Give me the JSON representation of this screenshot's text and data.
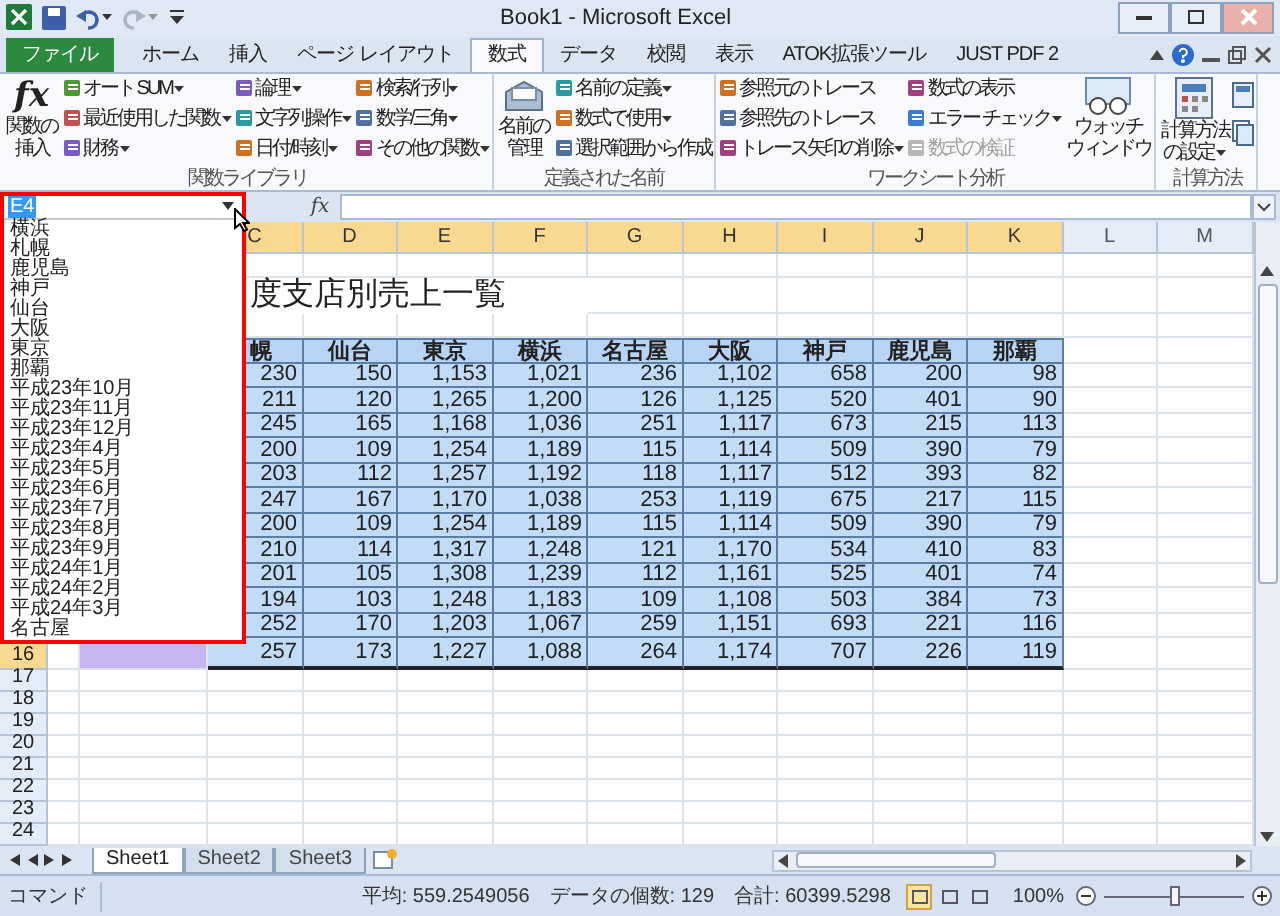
{
  "window": {
    "title": "Book1 - Microsoft Excel"
  },
  "ribbon_tabs": [
    {
      "label": "ファイル",
      "kind": "file",
      "selected": false
    },
    {
      "label": "ホーム",
      "kind": "tab",
      "selected": false
    },
    {
      "label": "挿入",
      "kind": "tab",
      "selected": false
    },
    {
      "label": "ページ レイアウト",
      "kind": "tab",
      "selected": false
    },
    {
      "label": "数式",
      "kind": "tab",
      "selected": true
    },
    {
      "label": "データ",
      "kind": "tab",
      "selected": false
    },
    {
      "label": "校閲",
      "kind": "tab",
      "selected": false
    },
    {
      "label": "表示",
      "kind": "tab",
      "selected": false
    },
    {
      "label": "ATOK拡張ツール",
      "kind": "tab",
      "selected": false
    },
    {
      "label": "JUST PDF 2",
      "kind": "tab",
      "selected": false
    }
  ],
  "ribbon_groups": [
    {
      "label": "関数ライブラリ",
      "parts": [
        {
          "kind": "big",
          "glyph": "fx",
          "lines": [
            "関数の",
            "挿入"
          ],
          "dropdown": false
        },
        {
          "kind": "stack",
          "items": [
            {
              "label": "オート SUM",
              "dropdown": true,
              "disabled": false
            },
            {
              "label": "最近使用した関数",
              "dropdown": true,
              "disabled": false
            },
            {
              "label": "財務",
              "dropdown": true,
              "disabled": false
            }
          ]
        },
        {
          "kind": "stack",
          "items": [
            {
              "label": "論理",
              "dropdown": true,
              "disabled": false
            },
            {
              "label": "文字列操作",
              "dropdown": true,
              "disabled": false
            },
            {
              "label": "日付/時刻",
              "dropdown": true,
              "disabled": false
            }
          ]
        },
        {
          "kind": "stack",
          "items": [
            {
              "label": "検索/行列",
              "dropdown": true,
              "disabled": false
            },
            {
              "label": "数学/三角",
              "dropdown": true,
              "disabled": false
            },
            {
              "label": "その他の関数",
              "dropdown": true,
              "disabled": false
            }
          ]
        }
      ]
    },
    {
      "label": "定義された名前",
      "parts": [
        {
          "kind": "big",
          "lines": [
            "名前の",
            "管理"
          ],
          "dropdown": false
        },
        {
          "kind": "stack",
          "items": [
            {
              "label": "名前の定義",
              "dropdown": true,
              "disabled": false
            },
            {
              "label": "数式で使用",
              "dropdown": true,
              "disabled": false
            },
            {
              "label": "選択範囲から作成",
              "dropdown": false,
              "disabled": false
            }
          ]
        }
      ]
    },
    {
      "label": "ワークシート分析",
      "parts": [
        {
          "kind": "stack",
          "items": [
            {
              "label": "参照元のトレース",
              "dropdown": false,
              "disabled": false
            },
            {
              "label": "参照先のトレース",
              "dropdown": false,
              "disabled": false
            },
            {
              "label": "トレース矢印の削除",
              "dropdown": true,
              "disabled": false
            }
          ]
        },
        {
          "kind": "stack",
          "items": [
            {
              "label": "数式の表示",
              "dropdown": false,
              "disabled": false
            },
            {
              "label": "エラー チェック",
              "dropdown": true,
              "disabled": false
            },
            {
              "label": "数式の検証",
              "dropdown": false,
              "disabled": true
            }
          ]
        },
        {
          "kind": "big",
          "lines": [
            "ウォッチ",
            "ウィンドウ"
          ],
          "dropdown": false
        }
      ]
    },
    {
      "label": "計算方法",
      "parts": [
        {
          "kind": "big",
          "lines": [
            "計算方法",
            "の設定"
          ],
          "dropdown": true
        },
        {
          "kind": "icons"
        }
      ]
    }
  ],
  "name_box": {
    "value": "E4"
  },
  "name_list": [
    "横浜",
    "札幌",
    "鹿児島",
    "神戸",
    "仙台",
    "大阪",
    "東京",
    "那覇",
    "平成23年10月",
    "平成23年11月",
    "平成23年12月",
    "平成23年4月",
    "平成23年5月",
    "平成23年6月",
    "平成23年7月",
    "平成23年8月",
    "平成23年9月",
    "平成24年1月",
    "平成24年2月",
    "平成24年3月",
    "名古屋"
  ],
  "formula_bar": {
    "fx": "fx"
  },
  "sheet": {
    "columns": [
      {
        "label": "C",
        "selected": true
      },
      {
        "label": "D",
        "selected": true
      },
      {
        "label": "E",
        "selected": true
      },
      {
        "label": "F",
        "selected": true
      },
      {
        "label": "G",
        "selected": true
      },
      {
        "label": "H",
        "selected": true
      },
      {
        "label": "I",
        "selected": true
      },
      {
        "label": "J",
        "selected": true
      },
      {
        "label": "K",
        "selected": true
      },
      {
        "label": "L",
        "selected": false
      },
      {
        "label": "M",
        "selected": false
      }
    ],
    "row_headers": [
      {
        "label": "16",
        "selected": true
      },
      {
        "label": "17",
        "selected": false
      },
      {
        "label": "18",
        "selected": false
      },
      {
        "label": "19",
        "selected": false
      },
      {
        "label": "20",
        "selected": false
      },
      {
        "label": "21",
        "selected": false
      },
      {
        "label": "22",
        "selected": false
      },
      {
        "label": "23",
        "selected": false
      },
      {
        "label": "24",
        "selected": false
      }
    ],
    "title": "度支店別売上一覧",
    "table": {
      "header": [
        "幌",
        "仙台",
        "東京",
        "横浜",
        "名古屋",
        "大阪",
        "神戸",
        "鹿児島",
        "那覇"
      ],
      "rows": [
        [
          "230",
          "150",
          "1,153",
          "1,021",
          "236",
          "1,102",
          "658",
          "200",
          "98"
        ],
        [
          "211",
          "120",
          "1,265",
          "1,200",
          "126",
          "1,125",
          "520",
          "401",
          "90"
        ],
        [
          "245",
          "165",
          "1,168",
          "1,036",
          "251",
          "1,117",
          "673",
          "215",
          "113"
        ],
        [
          "200",
          "109",
          "1,254",
          "1,189",
          "115",
          "1,114",
          "509",
          "390",
          "79"
        ],
        [
          "203",
          "112",
          "1,257",
          "1,192",
          "118",
          "1,117",
          "512",
          "393",
          "82"
        ],
        [
          "247",
          "167",
          "1,170",
          "1,038",
          "253",
          "1,119",
          "675",
          "217",
          "115"
        ],
        [
          "200",
          "109",
          "1,254",
          "1,189",
          "115",
          "1,114",
          "509",
          "390",
          "79"
        ],
        [
          "210",
          "114",
          "1,317",
          "1,248",
          "121",
          "1,170",
          "534",
          "410",
          "83"
        ],
        [
          "201",
          "105",
          "1,308",
          "1,239",
          "112",
          "1,161",
          "525",
          "401",
          "74"
        ],
        [
          "194",
          "103",
          "1,248",
          "1,183",
          "109",
          "1,108",
          "503",
          "384",
          "73"
        ],
        [
          "252",
          "170",
          "1,203",
          "1,067",
          "259",
          "1,151",
          "693",
          "221",
          "116"
        ],
        [
          "257",
          "173",
          "1,227",
          "1,088",
          "264",
          "1,174",
          "707",
          "226",
          "119"
        ]
      ]
    }
  },
  "sheet_tabs": [
    {
      "label": "Sheet1",
      "selected": true
    },
    {
      "label": "Sheet2",
      "selected": false
    },
    {
      "label": "Sheet3",
      "selected": false
    }
  ],
  "status_bar": {
    "mode": "コマンド",
    "average": "平均: 559.2549056",
    "count": "データの個数: 129",
    "sum": "合計: 60399.5298",
    "zoom": "100%",
    "zoom_slider": {
      "level": 0.5
    },
    "views": [
      {
        "selected": true
      },
      {
        "selected": false
      },
      {
        "selected": false
      }
    ]
  }
}
